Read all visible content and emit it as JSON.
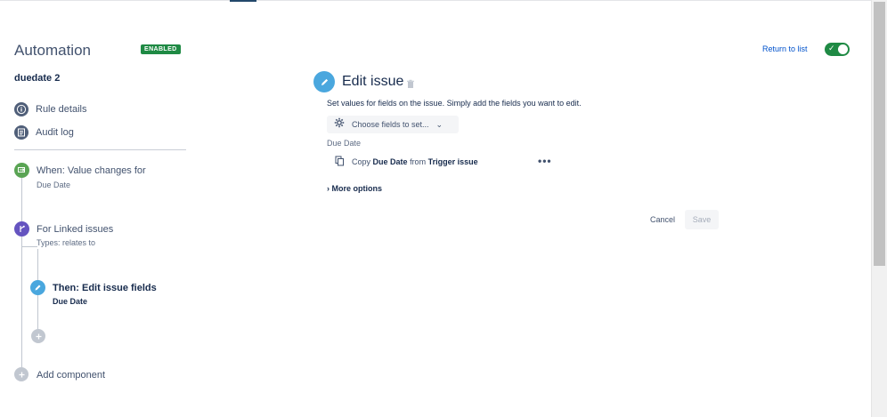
{
  "header": {
    "title": "Automation",
    "status_badge": "ENABLED",
    "return_link": "Return to list",
    "toggle_state": "on"
  },
  "rule": {
    "name": "duedate 2"
  },
  "nav": {
    "items": [
      {
        "label": "Rule details",
        "icon": "info-icon"
      },
      {
        "label": "Audit log",
        "icon": "list-icon"
      }
    ]
  },
  "flow": {
    "trigger": {
      "title": "When: Value changes for",
      "subtitle": "Due Date",
      "color": "#5aa454"
    },
    "branch": {
      "title": "For Linked issues",
      "subtitle": "Types: relates to",
      "color": "#6554c0"
    },
    "action": {
      "title": "Then: Edit issue fields",
      "subtitle": "Due Date",
      "color": "#4aa7de"
    },
    "add_component": "Add component"
  },
  "editor": {
    "title": "Edit issue",
    "description": "Set values for fields on the issue. Simply add the fields you want to edit.",
    "choose_fields": "Choose fields to set...",
    "field_label": "Due Date",
    "copy": {
      "prefix": "Copy",
      "field": "Due Date",
      "middle": "from",
      "source": "Trigger issue"
    },
    "more_options": "More options",
    "cancel": "Cancel",
    "save": "Save"
  },
  "colors": {
    "accent": "#0052cc",
    "enabled": "#1f8a44",
    "edit": "#4aa7de"
  }
}
